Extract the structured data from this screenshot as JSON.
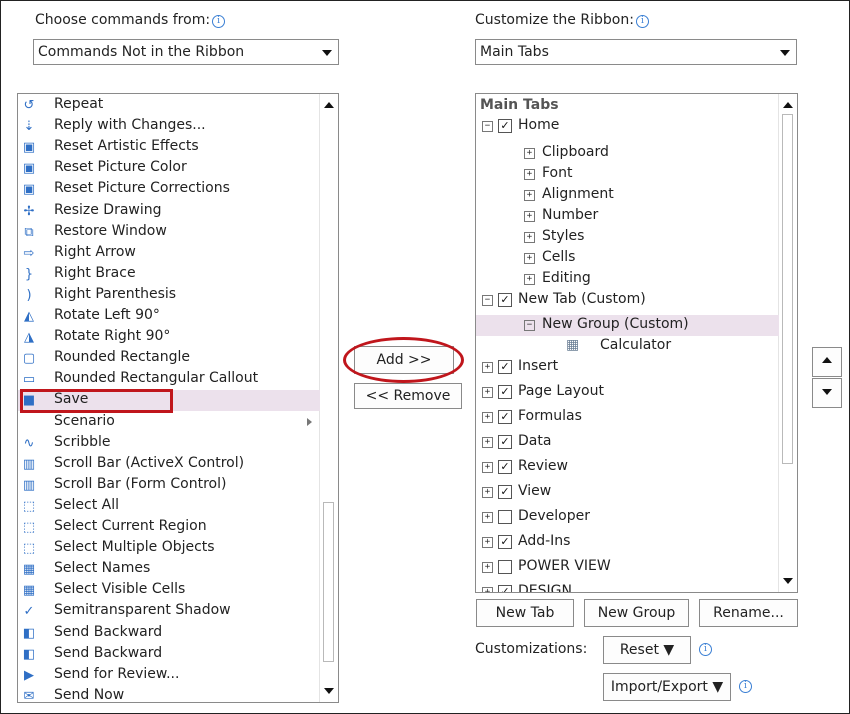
{
  "left": {
    "label": "Choose commands from:",
    "dropdown_value": "Commands Not in the Ribbon",
    "commands": [
      {
        "label": "Repeat",
        "icon": "repeat-icon",
        "glyph": "↺"
      },
      {
        "label": "Reply with Changes...",
        "icon": "reply-changes-icon",
        "glyph": "⇣"
      },
      {
        "label": "Reset Artistic Effects",
        "icon": "reset-artistic-icon",
        "glyph": "▣"
      },
      {
        "label": "Reset Picture Color",
        "icon": "reset-color-icon",
        "glyph": "▣"
      },
      {
        "label": "Reset Picture Corrections",
        "icon": "reset-corrections-icon",
        "glyph": "▣"
      },
      {
        "label": "Resize Drawing",
        "icon": "resize-drawing-icon",
        "glyph": "✢"
      },
      {
        "label": "Restore Window",
        "icon": "restore-window-icon",
        "glyph": "⧉"
      },
      {
        "label": "Right Arrow",
        "icon": "right-arrow-icon",
        "glyph": "⇨"
      },
      {
        "label": "Right Brace",
        "icon": "right-brace-icon",
        "glyph": "}"
      },
      {
        "label": "Right Parenthesis",
        "icon": "right-parenthesis-icon",
        "glyph": ")"
      },
      {
        "label": "Rotate Left 90°",
        "icon": "rotate-left-icon",
        "glyph": "◭"
      },
      {
        "label": "Rotate Right 90°",
        "icon": "rotate-right-icon",
        "glyph": "◮"
      },
      {
        "label": "Rounded Rectangle",
        "icon": "rounded-rectangle-icon",
        "glyph": "▢"
      },
      {
        "label": "Rounded Rectangular Callout",
        "icon": "callout-icon",
        "glyph": "▭"
      },
      {
        "label": "Save",
        "icon": "save-icon",
        "glyph": "■"
      },
      {
        "label": "Scenario",
        "icon": "",
        "glyph": ""
      },
      {
        "label": "Scribble",
        "icon": "scribble-icon",
        "glyph": "∿"
      },
      {
        "label": "Scroll Bar (ActiveX Control)",
        "icon": "scrollbar-activex-icon",
        "glyph": "▥"
      },
      {
        "label": "Scroll Bar (Form Control)",
        "icon": "scrollbar-form-icon",
        "glyph": "▥"
      },
      {
        "label": "Select All",
        "icon": "select-all-icon",
        "glyph": "⬚"
      },
      {
        "label": "Select Current Region",
        "icon": "select-region-icon",
        "glyph": "⬚"
      },
      {
        "label": "Select Multiple Objects",
        "icon": "select-multiple-icon",
        "glyph": "⬚"
      },
      {
        "label": "Select Names",
        "icon": "select-names-icon",
        "glyph": "▦"
      },
      {
        "label": "Select Visible Cells",
        "icon": "select-visible-icon",
        "glyph": "▦"
      },
      {
        "label": "Semitransparent Shadow",
        "icon": "shadow-check-icon",
        "glyph": "✓"
      },
      {
        "label": "Send Backward",
        "icon": "send-backward-icon",
        "glyph": "◧"
      },
      {
        "label": "Send Backward",
        "icon": "send-backward-2-icon",
        "glyph": "◧"
      },
      {
        "label": "Send for Review...",
        "icon": "send-review-icon",
        "glyph": "▶"
      },
      {
        "label": "Send Now",
        "icon": "send-now-icon",
        "glyph": "✉"
      }
    ]
  },
  "middle": {
    "add_label": "Add >>",
    "remove_label": "<< Remove"
  },
  "right": {
    "label": "Customize the Ribbon:",
    "dropdown_value": "Main Tabs",
    "tree": [
      {
        "label": "Main Tabs",
        "level": 0,
        "expander": "",
        "check": "none",
        "header": true
      },
      {
        "label": "Home",
        "level": 1,
        "expander": "⊟",
        "check": "checked"
      },
      {
        "label": "Clipboard",
        "level": 2,
        "expander": "⊞",
        "check": "none"
      },
      {
        "label": "Font",
        "level": 2,
        "expander": "⊞",
        "check": "none"
      },
      {
        "label": "Alignment",
        "level": 2,
        "expander": "⊞",
        "check": "none"
      },
      {
        "label": "Number",
        "level": 2,
        "expander": "⊞",
        "check": "none"
      },
      {
        "label": "Styles",
        "level": 2,
        "expander": "⊞",
        "check": "none"
      },
      {
        "label": "Cells",
        "level": 2,
        "expander": "⊞",
        "check": "none"
      },
      {
        "label": "Editing",
        "level": 2,
        "expander": "⊞",
        "check": "none"
      },
      {
        "label": "New Tab (Custom)",
        "level": 1,
        "expander": "⊟",
        "check": "checked"
      },
      {
        "label": "New Group (Custom)",
        "level": 2,
        "expander": "⊟",
        "check": "none",
        "selected": true
      },
      {
        "label": "Calculator",
        "level": 3,
        "expander": "",
        "check": "none",
        "icon": "calculator-icon"
      },
      {
        "label": "Insert",
        "level": 1,
        "expander": "⊞",
        "check": "checked"
      },
      {
        "label": "Page Layout",
        "level": 1,
        "expander": "⊞",
        "check": "checked"
      },
      {
        "label": "Formulas",
        "level": 1,
        "expander": "⊞",
        "check": "checked"
      },
      {
        "label": "Data",
        "level": 1,
        "expander": "⊞",
        "check": "checked"
      },
      {
        "label": "Review",
        "level": 1,
        "expander": "⊞",
        "check": "checked"
      },
      {
        "label": "View",
        "level": 1,
        "expander": "⊞",
        "check": "checked"
      },
      {
        "label": "Developer",
        "level": 1,
        "expander": "⊞",
        "check": "unchecked"
      },
      {
        "label": "Add-Ins",
        "level": 1,
        "expander": "⊞",
        "check": "checked"
      },
      {
        "label": "POWER VIEW",
        "level": 1,
        "expander": "⊞",
        "check": "unchecked"
      },
      {
        "label": "DESIGN",
        "level": 1,
        "expander": "⊞",
        "check": "checked"
      }
    ],
    "new_tab_label": "New Tab",
    "new_group_label": "New Group",
    "rename_label": "Rename...",
    "customizations_label": "Customizations:",
    "reset_label": "Reset ▼",
    "import_export_label": "Import/Export ▼"
  },
  "colors": {
    "selection": "#ece1ec",
    "highlight_red": "#c0161c",
    "info_blue": "#3a7fd4"
  }
}
